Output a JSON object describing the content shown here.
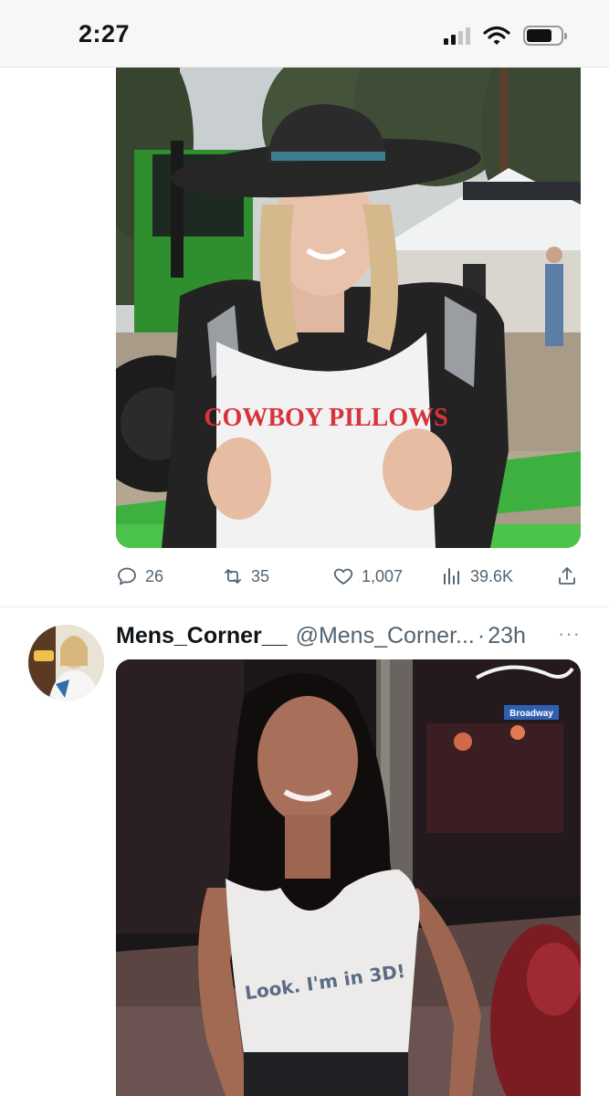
{
  "status_bar": {
    "time": "2:27",
    "icons": [
      "cellular-signal-icon",
      "wifi-icon",
      "battery-icon"
    ]
  },
  "tweets": [
    {
      "media": {
        "shirt_text": "COWBOY PILLOWS",
        "content": "photo"
      },
      "actions": {
        "replies": "26",
        "retweets": "35",
        "likes": "1,007",
        "views": "39.6K"
      }
    },
    {
      "author": {
        "display_name": "Mens_Corner__",
        "handle": "@Mens_Corner...",
        "separator": "·",
        "time": "23h"
      },
      "more_label": "···",
      "media": {
        "shirt_text": "Look. I'm in 3D!",
        "street_sign": "Broadway",
        "content": "photo"
      }
    }
  ],
  "colors": {
    "text_primary": "#0f1419",
    "text_secondary": "#536471",
    "divider": "#e8ebed"
  }
}
